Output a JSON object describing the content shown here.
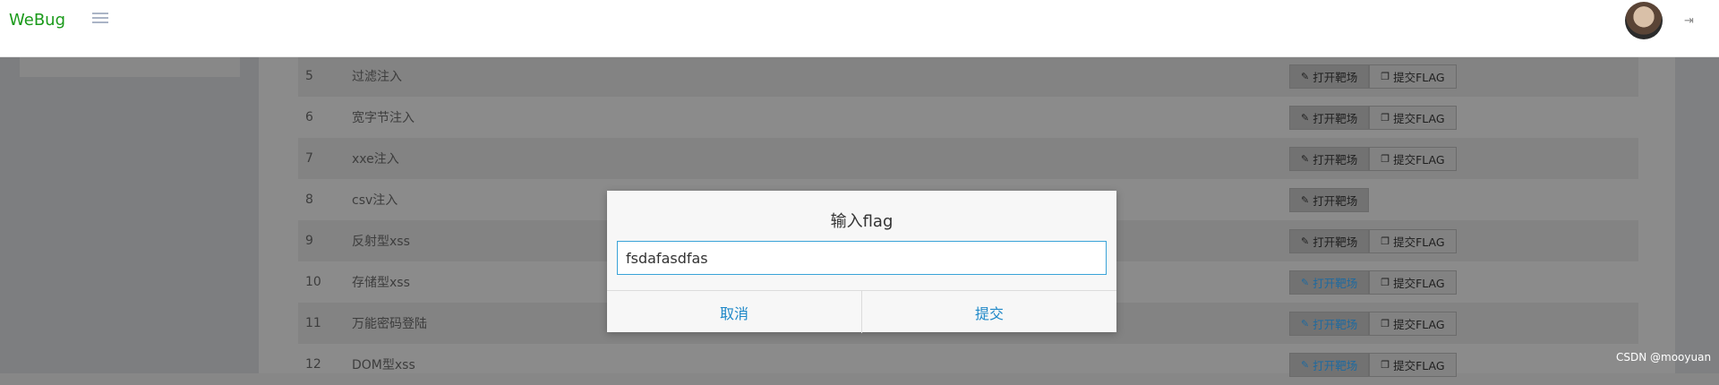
{
  "topbar": {
    "logo": "WeBug",
    "menu_icon": "list-icon",
    "avatar_icon": "user-avatar",
    "logout_icon": "sign-out-icon"
  },
  "rows": [
    {
      "num": "5",
      "name": "过滤注入",
      "open": "打开靶场",
      "submit": "提交FLAG"
    },
    {
      "num": "6",
      "name": "宽字节注入",
      "open": "打开靶场",
      "submit": "提交FLAG"
    },
    {
      "num": "7",
      "name": "xxe注入",
      "open": "打开靶场",
      "submit": "提交FLAG"
    },
    {
      "num": "8",
      "name": "csv注入",
      "open": "打开靶场",
      "submit": ""
    },
    {
      "num": "9",
      "name": "反射型xss",
      "open": "打开靶场",
      "submit": "提交FLAG"
    },
    {
      "num": "10",
      "name": "存储型xss",
      "open": "打开靶场",
      "submit": "提交FLAG"
    },
    {
      "num": "11",
      "name": "万能密码登陆",
      "open": "打开靶场",
      "submit": "提交FLAG"
    },
    {
      "num": "12",
      "name": "DOM型xss",
      "open": "打开靶场",
      "submit": "提交FLAG"
    }
  ],
  "modal": {
    "title": "输入flag",
    "input_value": "fsdafasdfas",
    "cancel": "取消",
    "submit": "提交"
  },
  "watermark": "CSDN @mooyuan",
  "colors": {
    "logo": "#1a9a1a",
    "accent": "#1e88c8",
    "input_border": "#3aa3d8"
  }
}
